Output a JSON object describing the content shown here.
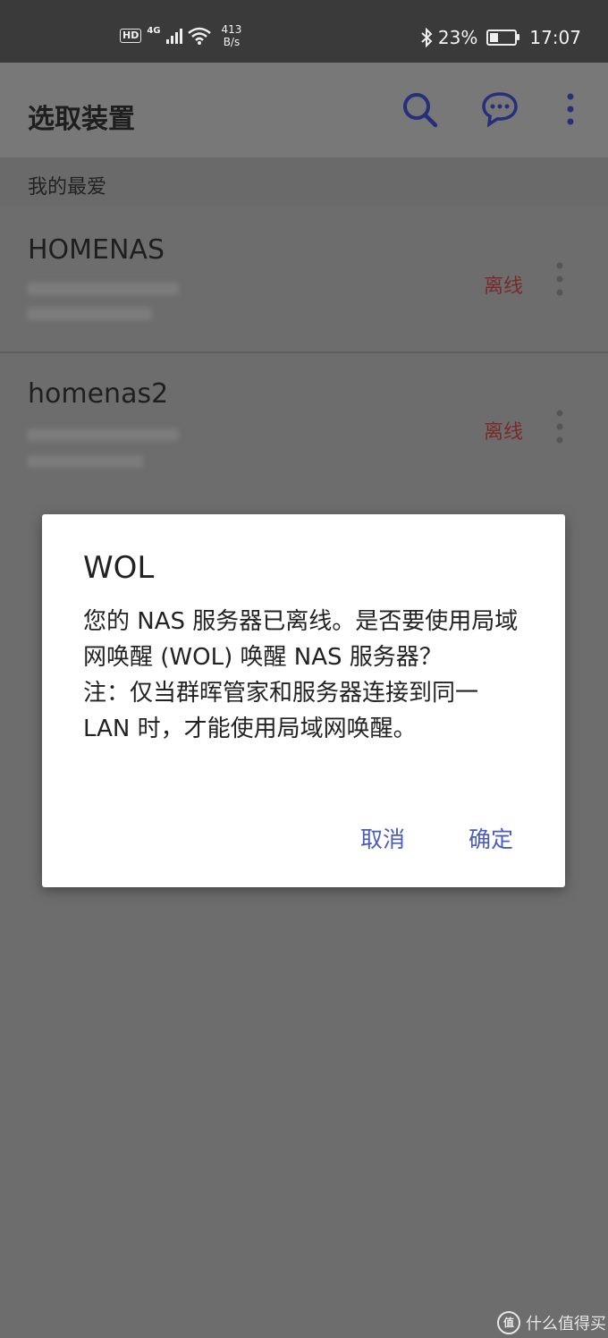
{
  "status_bar": {
    "hd": "HD",
    "network": "4G",
    "speed_value": "413",
    "speed_unit": "B/s",
    "battery_percent": "23%",
    "time": "17:07"
  },
  "app_bar": {
    "title": "选取装置",
    "icons": [
      "search-icon",
      "chat-icon",
      "more-vert-icon"
    ]
  },
  "section_header": "我的最爱",
  "devices": [
    {
      "name": "HOMENAS",
      "status": "离线"
    },
    {
      "name": "homenas2",
      "status": "离线"
    }
  ],
  "dialog": {
    "title": "WOL",
    "body": "您的 NAS 服务器已离线。是否要使用局域网唤醒 (WOL) 唤醒 NAS 服务器？\n注：仅当群晖管家和服务器连接到同一 LAN 时，才能使用局域网唤醒。",
    "cancel_label": "取消",
    "ok_label": "确定"
  },
  "watermark": {
    "icon_text": "值",
    "text": "什么值得买"
  },
  "colors": {
    "accent": "#4a5cc4",
    "offline": "#b03a3a",
    "overlay": "#6d6d6d"
  }
}
